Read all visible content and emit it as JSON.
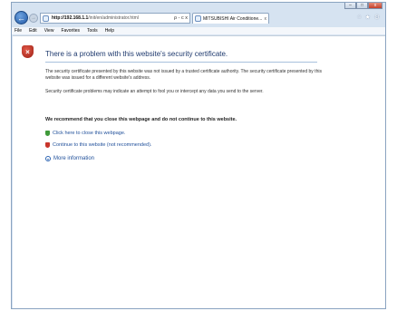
{
  "window": {
    "caption_buttons": [
      "–",
      "□",
      "x"
    ]
  },
  "toolbar": {
    "back_icon": "←",
    "forward_icon": "→",
    "url_host": "http://192.168.1.1",
    "url_path": "/init/en/administrator.html",
    "address_tools": "ρ - c x",
    "tab_label": "MITSUBISHI Air Conditione...",
    "tab_close": "x",
    "right_icons": [
      "home-icon",
      "star-icon",
      "gear-icon"
    ]
  },
  "menu": [
    "File",
    "Edit",
    "View",
    "Favorites",
    "Tools",
    "Help"
  ],
  "content": {
    "title": "There is a problem with this website's security certificate.",
    "para1": "The security certificate presented by this website was not issued by a trusted certificate authority. The security certificate presented by this website was issued for a different website's address.",
    "para2": "Security certificate problems may indicate an attempt to fool you or intercept any data you send to the server.",
    "recommend": "We recommend that you close this webpage and do not continue to this website.",
    "close_link": "Click here to close this webpage.",
    "continue_link": "Continue to this website (not recommended).",
    "more_info": "More information"
  },
  "colors": {
    "title": "#1f3a6e",
    "link": "#1f4f9a",
    "error_shield": "#c8352b",
    "ok_shield": "#3f9a3a"
  }
}
